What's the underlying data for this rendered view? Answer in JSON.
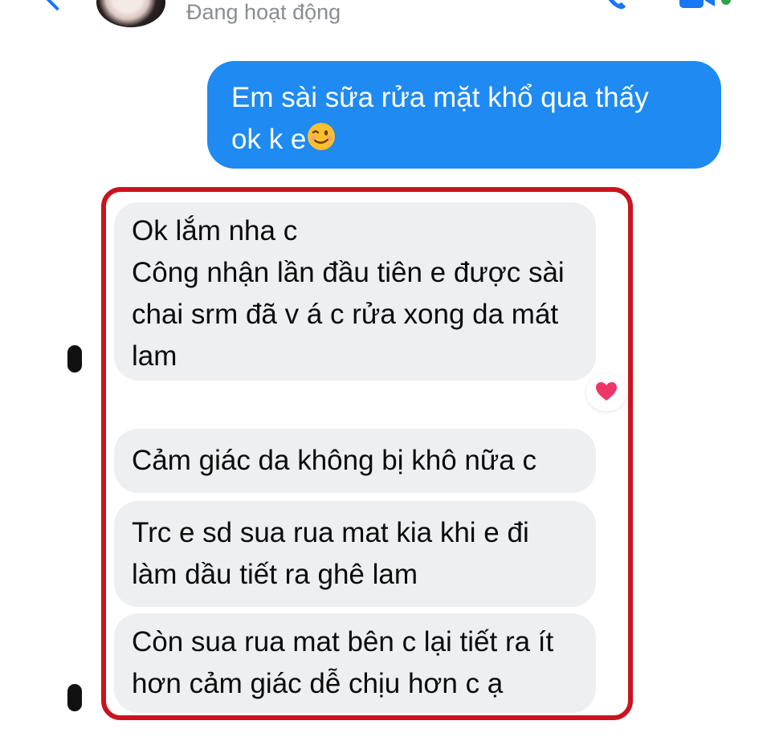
{
  "header": {
    "status": "Đang hoạt động",
    "icons": {
      "back": "chevron-left-icon",
      "phone": "phone-icon",
      "video": "video-icon"
    }
  },
  "messages": {
    "outgoing": {
      "text": "Em sài sữa rửa mặt khổ qua thấy\nok k e",
      "emoji": "😉"
    },
    "incoming": [
      {
        "text": "Ok lắm nha c\nCông nhận lần đầu tiên e được sài\nchai srm đã v á c rửa xong da mát\nlam"
      },
      {
        "text": "Cảm giác da không bị khô nữa c"
      },
      {
        "text": "Trc e sd sua rua mat kia khi e đi\nlàm dầu tiết ra ghê lam"
      },
      {
        "text": "Còn sua rua mat bên c lại tiết ra ít\nhơn cảm giác dễ chịu hơn c ạ"
      }
    ],
    "reaction": "heart-icon"
  },
  "colors": {
    "outgoing_bubble": "#1e8af2",
    "incoming_bubble": "#eeeff1",
    "highlight_frame": "#c8141e",
    "reaction_heart": "#f0356a"
  }
}
